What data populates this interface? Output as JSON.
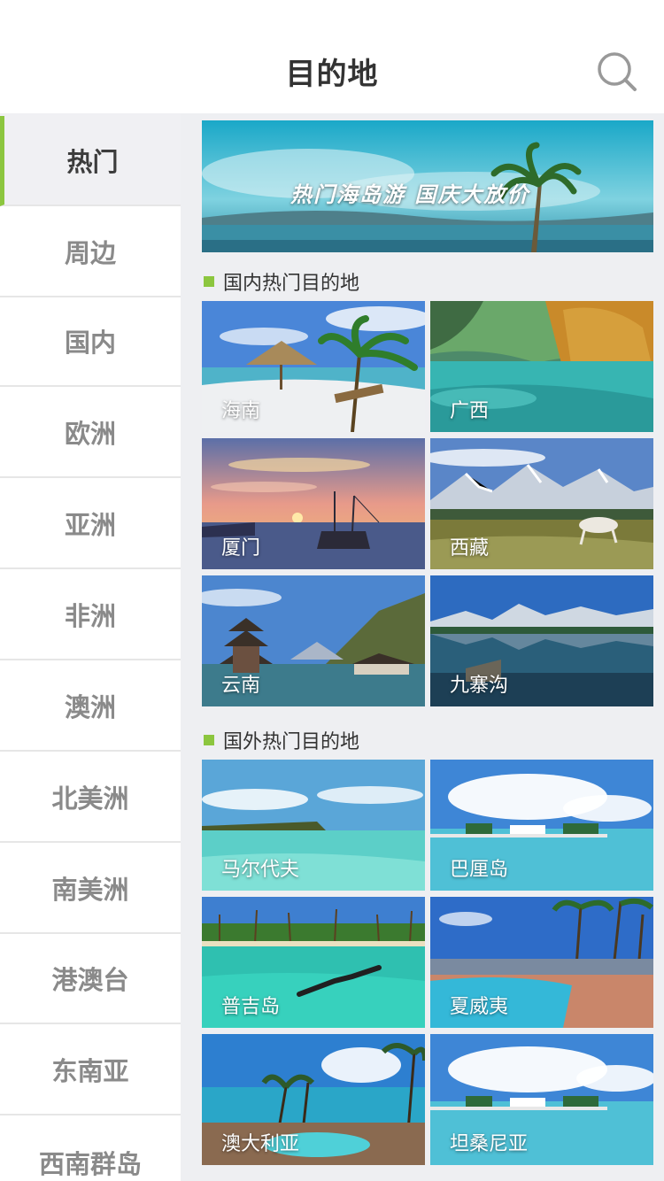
{
  "header": {
    "title": "目的地",
    "search_icon": "search-icon"
  },
  "sidebar": {
    "items": [
      {
        "label": "热门"
      },
      {
        "label": "周边"
      },
      {
        "label": "国内"
      },
      {
        "label": "欧洲"
      },
      {
        "label": "亚洲"
      },
      {
        "label": "非洲"
      },
      {
        "label": "澳洲"
      },
      {
        "label": "北美洲"
      },
      {
        "label": "南美洲"
      },
      {
        "label": "港澳台"
      },
      {
        "label": "东南亚"
      },
      {
        "label": "西南群岛"
      }
    ],
    "active_index": 0
  },
  "banner": {
    "text": "热门海岛游 国庆大放价"
  },
  "domestic": {
    "title": "国内热门目的地",
    "items": [
      {
        "label": "海南"
      },
      {
        "label": "广西"
      },
      {
        "label": "厦门"
      },
      {
        "label": "西藏"
      },
      {
        "label": "云南"
      },
      {
        "label": "九寨沟"
      }
    ]
  },
  "foreign": {
    "title": "国外热门目的地",
    "items": [
      {
        "label": "马尔代夫"
      },
      {
        "label": "巴厘岛"
      },
      {
        "label": "普吉岛"
      },
      {
        "label": "夏威夷"
      },
      {
        "label": "澳大利亚"
      },
      {
        "label": "坦桑尼亚"
      }
    ]
  },
  "colors": {
    "accent": "#8cc63f",
    "active_text": "#3c3c3c",
    "inactive_text": "#8a8a8a"
  }
}
